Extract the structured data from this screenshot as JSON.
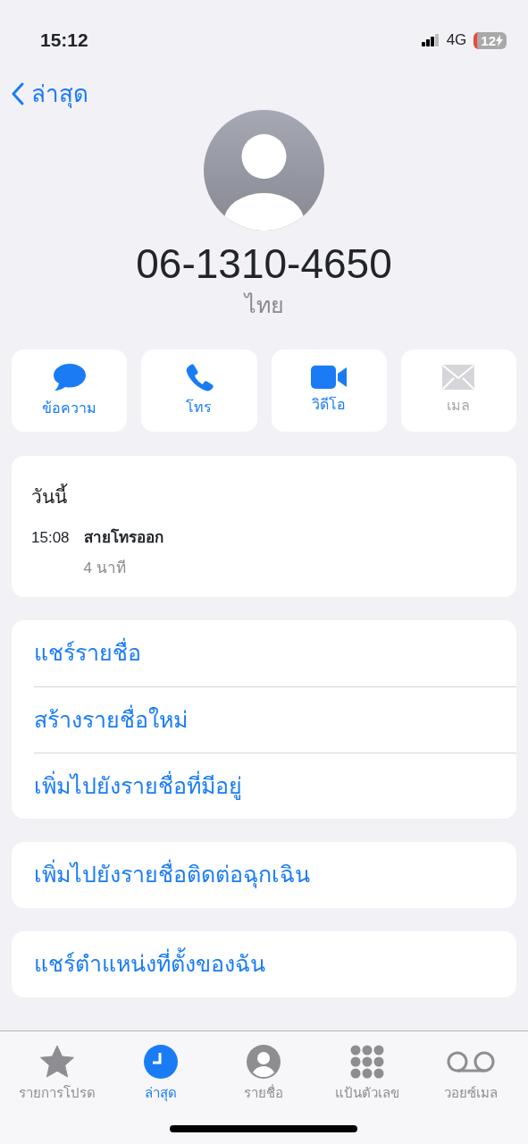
{
  "status_bar": {
    "time": "15:12",
    "network": "4G",
    "battery": "12",
    "charging": true
  },
  "nav": {
    "back": "ล่าสุด"
  },
  "contact": {
    "number": "06-1310-4650",
    "label": "ไทย"
  },
  "actions": [
    {
      "kind": "message",
      "label": "ข้อความ",
      "disabled": false
    },
    {
      "kind": "call",
      "label": "โทร",
      "disabled": false
    },
    {
      "kind": "video",
      "label": "วิดีโอ",
      "disabled": false
    },
    {
      "kind": "mail",
      "label": "เมล",
      "disabled": true
    }
  ],
  "recents": {
    "heading": "วันนี้",
    "calls": [
      {
        "time": "15:08",
        "type": "สายโทรออก",
        "duration": "4 นาที"
      }
    ]
  },
  "option_groups": [
    [
      "แชร์รายชื่อ",
      "สร้างรายชื่อใหม่",
      "เพิ่มไปยังรายชื่อที่มีอยู่"
    ],
    [
      "เพิ่มไปยังรายชื่อติดต่อฉุกเฉิน"
    ],
    [
      "แชร์ตำแหน่งที่ตั้งของฉัน"
    ]
  ],
  "tab_bar": [
    {
      "kind": "favorites",
      "label": "รายการโปรด",
      "selected": false
    },
    {
      "kind": "recents",
      "label": "ล่าสุด",
      "selected": true
    },
    {
      "kind": "contacts",
      "label": "รายชื่อ",
      "selected": false
    },
    {
      "kind": "keypad",
      "label": "แป้นตัวเลข",
      "selected": false
    },
    {
      "kind": "voicemail",
      "label": "วอยซ์เมล",
      "selected": false
    }
  ]
}
